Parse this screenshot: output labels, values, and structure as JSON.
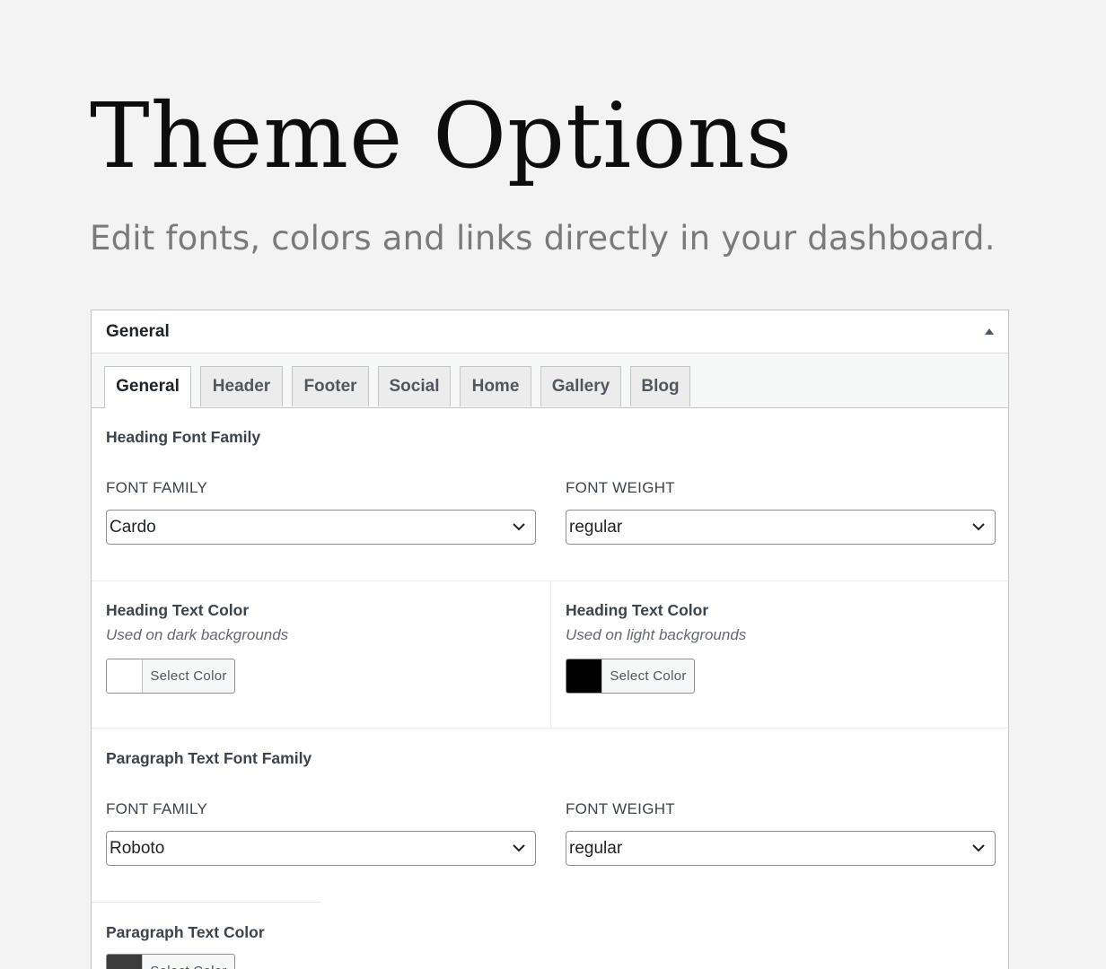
{
  "page": {
    "title": "Theme Options",
    "subtitle": "Edit fonts, colors and links directly in your dashboard."
  },
  "panel": {
    "title": "General",
    "toggle_icon": "triangle-up-icon",
    "tabs": [
      {
        "label": "General",
        "active": true
      },
      {
        "label": "Header",
        "active": false
      },
      {
        "label": "Footer",
        "active": false
      },
      {
        "label": "Social",
        "active": false
      },
      {
        "label": "Home",
        "active": false
      },
      {
        "label": "Gallery",
        "active": false
      },
      {
        "label": "Blog",
        "active": false
      }
    ]
  },
  "heading_font": {
    "title": "Heading Font Family",
    "family_label": "FONT FAMILY",
    "family_value": "Cardo",
    "weight_label": "FONT WEIGHT",
    "weight_value": "regular"
  },
  "heading_colors": {
    "dark": {
      "title": "Heading Text Color",
      "description": "Used on dark backgrounds",
      "button_label": "Select Color",
      "swatch_color": "#ffffff"
    },
    "light": {
      "title": "Heading Text Color",
      "description": "Used on light backgrounds",
      "button_label": "Select Color",
      "swatch_color": "#000000"
    }
  },
  "paragraph_font": {
    "title": "Paragraph Text Font Family",
    "family_label": "FONT FAMILY",
    "family_value": "Roboto",
    "weight_label": "FONT WEIGHT",
    "weight_value": "regular"
  },
  "paragraph_color": {
    "title": "Paragraph Text Color",
    "button_label": "Select Color",
    "swatch_color": "#3c3c3c"
  }
}
